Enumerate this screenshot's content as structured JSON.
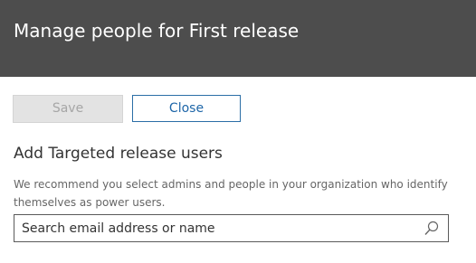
{
  "header": {
    "title": "Manage people for First release"
  },
  "toolbar": {
    "save_label": "Save",
    "close_label": "Close"
  },
  "section": {
    "title": "Add Targeted release users",
    "description": "We recommend you select admins and people in your organization who identify themselves as power users."
  },
  "search": {
    "placeholder": "Search email address or name",
    "value": "",
    "icon": "search-icon"
  },
  "colors": {
    "header_bg": "#4d4d4d",
    "accent": "#1e66a8",
    "disabled_bg": "#e3e3e3"
  }
}
